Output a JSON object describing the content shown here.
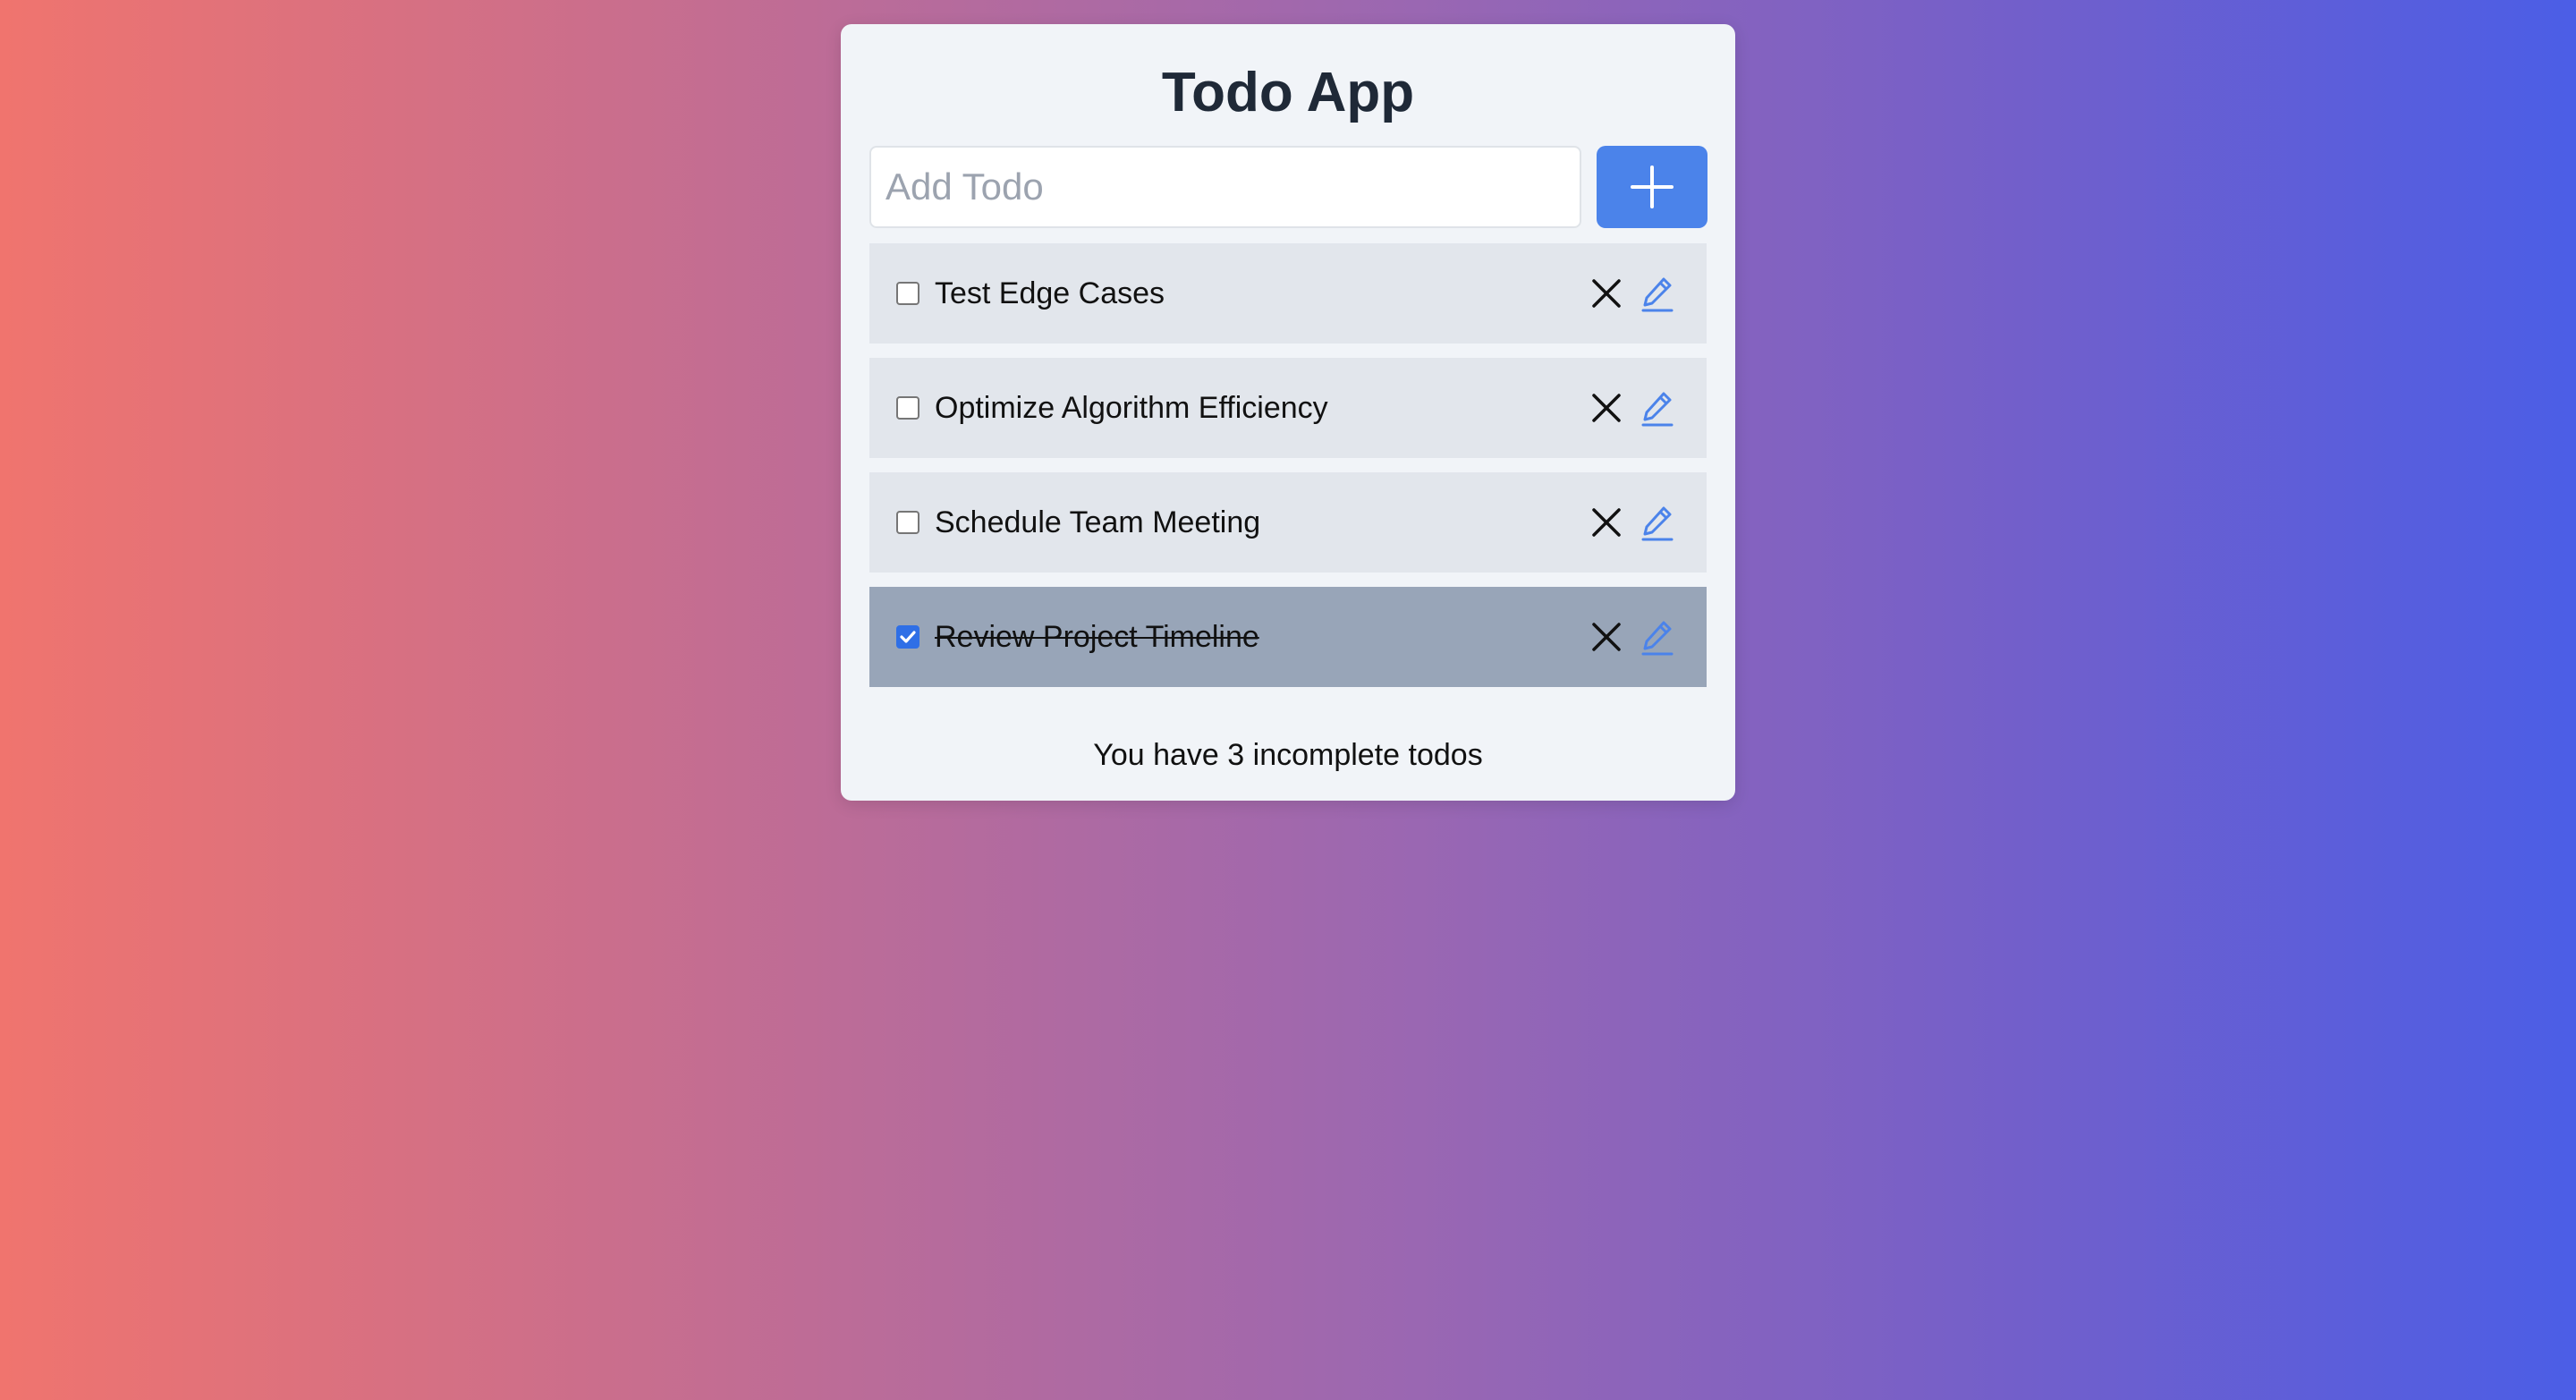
{
  "app": {
    "title": "Todo App"
  },
  "add_form": {
    "input_placeholder": "Add Todo",
    "input_value": "",
    "add_button_icon": "plus-icon"
  },
  "todos": [
    {
      "label": "Test Edge Cases",
      "completed": false
    },
    {
      "label": "Optimize Algorithm Efficiency",
      "completed": false
    },
    {
      "label": "Schedule Team Meeting",
      "completed": false
    },
    {
      "label": "Review Project Timeline",
      "completed": true
    }
  ],
  "item_actions": {
    "delete_icon": "close-icon",
    "edit_icon": "pencil-icon"
  },
  "footer": {
    "status_text": "You have 3 incomplete todos"
  },
  "colors": {
    "accent": "#4b83ea",
    "edit_icon": "#4b83ea",
    "checkbox_checked": "#2f6fe6",
    "item_bg": "#e2e6ec",
    "item_done_bg": "#98a5b8",
    "card_bg": "#f1f4f8",
    "gradient_start": "#f0746e",
    "gradient_end": "#4b5ee6"
  }
}
